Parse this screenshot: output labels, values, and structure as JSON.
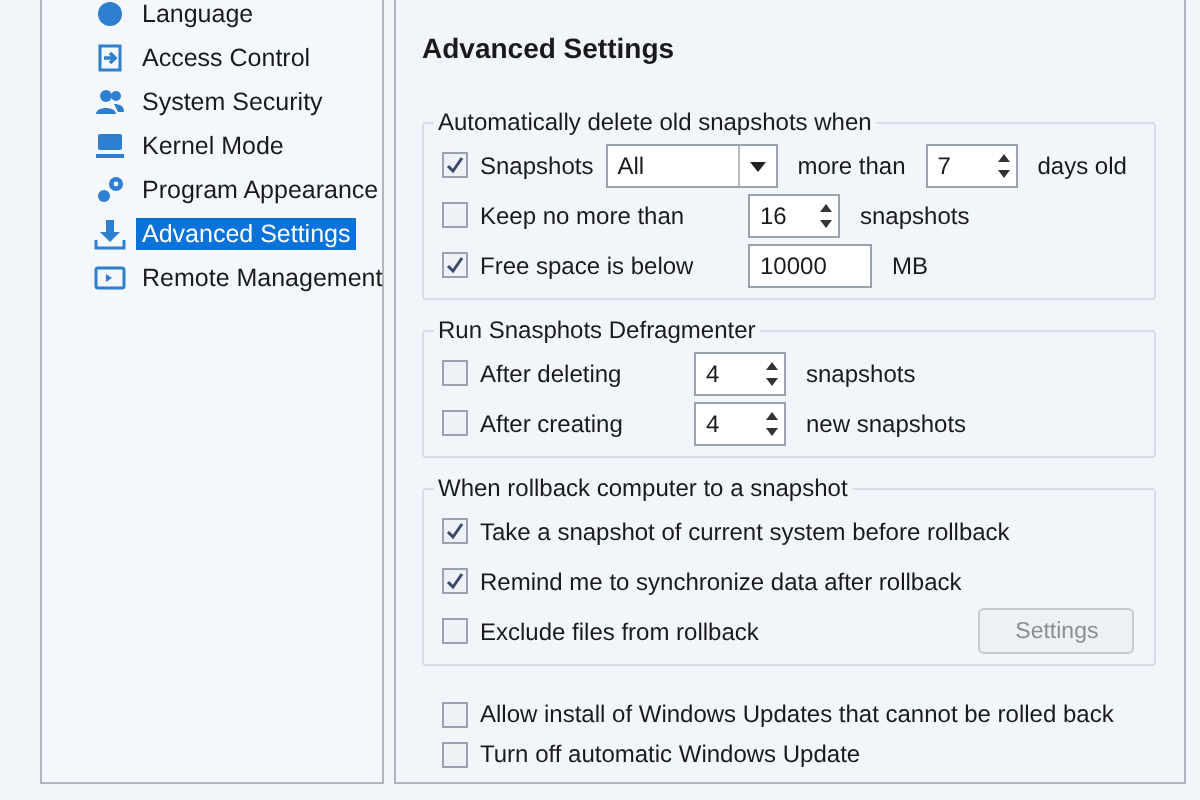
{
  "sidebar": {
    "items": [
      {
        "label": "Language",
        "selected": false
      },
      {
        "label": "Access Control",
        "selected": false
      },
      {
        "label": "System Security",
        "selected": false
      },
      {
        "label": "Kernel Mode",
        "selected": false
      },
      {
        "label": "Program Appearance",
        "selected": false
      },
      {
        "label": "Advanced Settings",
        "selected": true
      },
      {
        "label": "Remote Management",
        "selected": false
      }
    ]
  },
  "panel": {
    "title": "Advanced Settings",
    "groups": [
      {
        "legend": "Automatically delete old snapshots when",
        "rows": [
          {
            "label": "Snapshots",
            "checked": true,
            "controls": [
              {
                "kind": "dropdown",
                "value": "All"
              },
              {
                "kind": "text",
                "text": "more than"
              },
              {
                "kind": "spin",
                "value": "7"
              },
              {
                "kind": "text",
                "text": "days old"
              }
            ]
          },
          {
            "label": "Keep no more than",
            "checked": false,
            "controls": [
              {
                "kind": "spin",
                "value": "16"
              },
              {
                "kind": "text",
                "text": "snapshots"
              }
            ]
          },
          {
            "label": "Free space is below",
            "checked": true,
            "controls": [
              {
                "kind": "input",
                "value": "10000"
              },
              {
                "kind": "text",
                "text": "MB"
              }
            ]
          }
        ]
      },
      {
        "legend": "Run Snasphots Defragmenter",
        "rows": [
          {
            "label": "After deleting",
            "checked": false,
            "controls": [
              {
                "kind": "spin",
                "value": "4"
              },
              {
                "kind": "text",
                "text": "snapshots"
              }
            ]
          },
          {
            "label": "After creating",
            "checked": false,
            "controls": [
              {
                "kind": "spin",
                "value": "4"
              },
              {
                "kind": "text",
                "text": "new snapshots"
              }
            ]
          }
        ]
      },
      {
        "legend": "When rollback computer to a snapshot",
        "rows": [
          {
            "label": "Take a snapshot of current system before rollback",
            "checked": true,
            "controls": []
          },
          {
            "label": "Remind me to synchronize data after rollback",
            "checked": true,
            "controls": []
          },
          {
            "label": "Exclude files from rollback",
            "checked": false,
            "controls": [
              {
                "kind": "button",
                "label": "Settings",
                "disabled": true
              }
            ]
          }
        ]
      }
    ],
    "options": [
      {
        "label": "Allow install of Windows Updates that cannot be rolled back",
        "checked": false
      },
      {
        "label": "Turn off automatic Windows Update",
        "checked": false
      }
    ]
  }
}
